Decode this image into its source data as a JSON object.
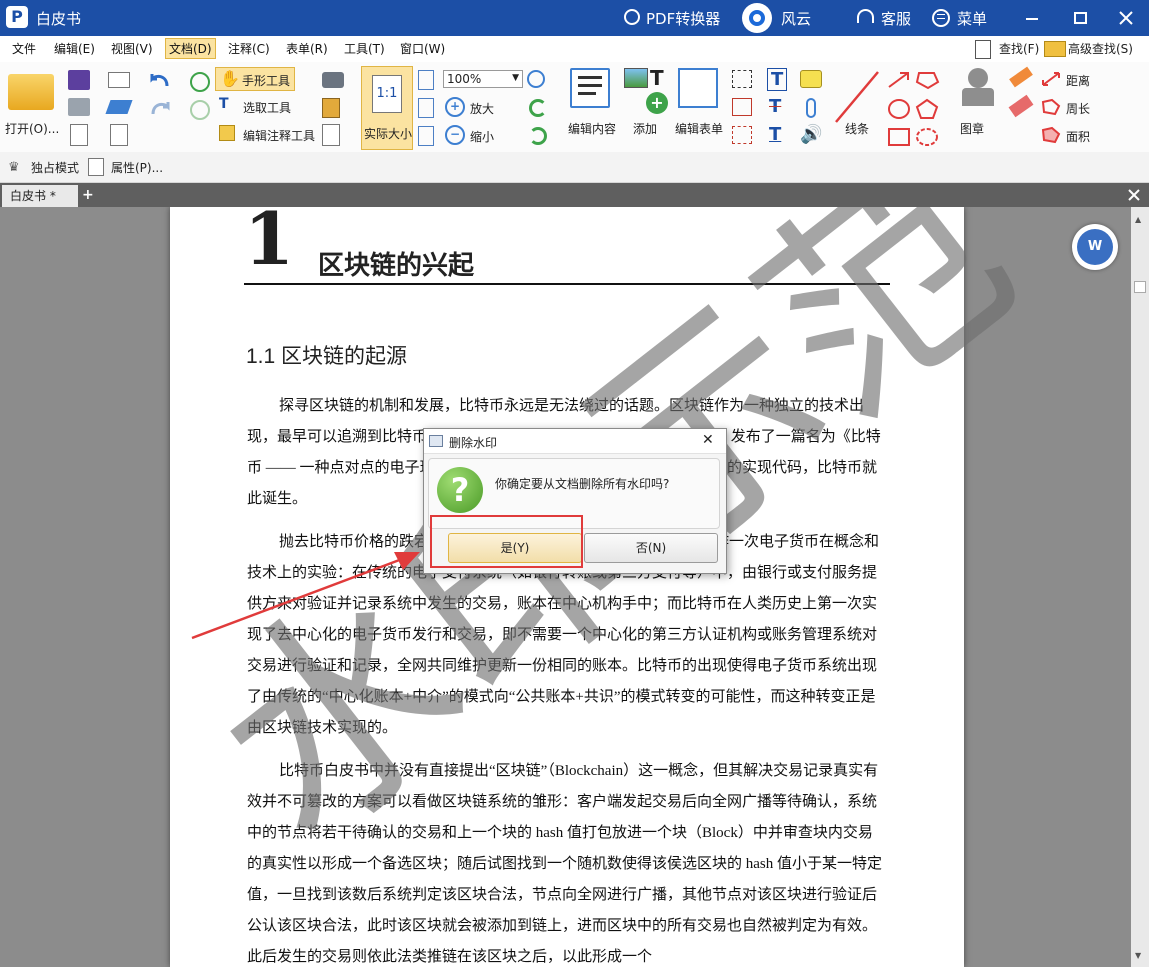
{
  "titlebar": {
    "app_title": "白皮书",
    "pdf_converter": "PDF转换器",
    "fengyun": "风云",
    "service": "客服",
    "menu": "菜单"
  },
  "menubar": {
    "items": [
      "文件",
      "编辑(E)",
      "视图(V)",
      "文档(D)",
      "注释(C)",
      "表单(R)",
      "工具(T)",
      "窗口(W)"
    ],
    "active_item": "文档(D)",
    "find": "查找(F)",
    "advanced_find": "高级查找(S)"
  },
  "ribbon": {
    "open": "打开(O)...",
    "hand_tool": "手形工具",
    "select_tool": "选取工具",
    "edit_annot_tool": "编辑注释工具",
    "actual_size": "实际大小",
    "actual_size_icon_text": "1:1",
    "zoom_value": "100%",
    "zoom_in": "放大",
    "zoom_out": "缩小",
    "edit_content": "编辑内容",
    "add": "添加",
    "edit_form": "编辑表单",
    "lines": "线条",
    "stamp": "图章",
    "distance": "距离",
    "perimeter": "周长",
    "area": "面积"
  },
  "toolbar2": {
    "exclusive_mode": "独占模式",
    "properties": "属性(P)..."
  },
  "tabs": {
    "doc_tab": "白皮书 *"
  },
  "document": {
    "chapter_number": "1",
    "chapter_title": "区块链的兴起",
    "section_title": "1.1 区块链的起源",
    "paragraphs": [
      "探寻区块链的机制和发展，比特币永远是无法绕过的话题。区块链作为一种独立的技术出现，最早可以追溯到比特币。2008 年，一个化名中本聪的个人（或团队）发布了一篇名为《比特币 —— 一种点对点的电子现金系统》的论文，并于 2009 年公开了其早期的实现代码，比特币就此诞生。",
      "抛去比特币价格的跌宕起伏和相关的投机与骗局，我们可以把它视作一次电子货币在概念和技术上的实验：在传统的电子支付系统（如银行转账或第三方支付等）中，由银行或支付服务提供方来对验证并记录系统中发生的交易，账本在中心机构手中；而比特币在人类历史上第一次实现了去中心化的电子货币发行和交易，即不需要一个中心化的第三方认证机构或账务管理系统对交易进行验证和记录，全网共同维护更新一份相同的账本。比特币的出现使得电子货币系统出现了由传统的“中心化账本+中介”的模式向“公共账本+共识”的模式转变的可能性，而这种转变正是由区块链技术实现的。",
      "比特币白皮书中并没有直接提出“区块链”（Blockchain）这一概念，但其解决交易记录真实有效并不可篡改的方案可以看做区块链系统的雏形：客户端发起交易后向全网广播等待确认，系统中的节点将若干待确认的交易和上一个块的 hash 值打包放进一个块（Block）中并审查块内交易的真实性以形成一个备选区块；随后试图找到一个随机数使得该侯选区块的 hash 值小于某一特定值，一旦找到该数后系统判定该区块合法，节点向全网进行广播，其他节点对该区块进行验证后公认该区块合法，此时该区块就会被添加到链上，进而区块中的所有交易也自然被判定为有效。此后发生的交易则依此法类推链在该区块之后，以此形成一个"
    ],
    "watermark_text": "水印示范"
  },
  "dialog": {
    "title": "删除水印",
    "message": "你确定要从文档删除所有水印吗?",
    "yes_button": "是(Y)",
    "no_button": "否(N)",
    "close": "✕"
  },
  "colors": {
    "titlebar": "#1c4fa6",
    "highlight_box": "#e03b3b",
    "arrow": "#e03b3b",
    "active_menu": "#fbe3a1"
  }
}
